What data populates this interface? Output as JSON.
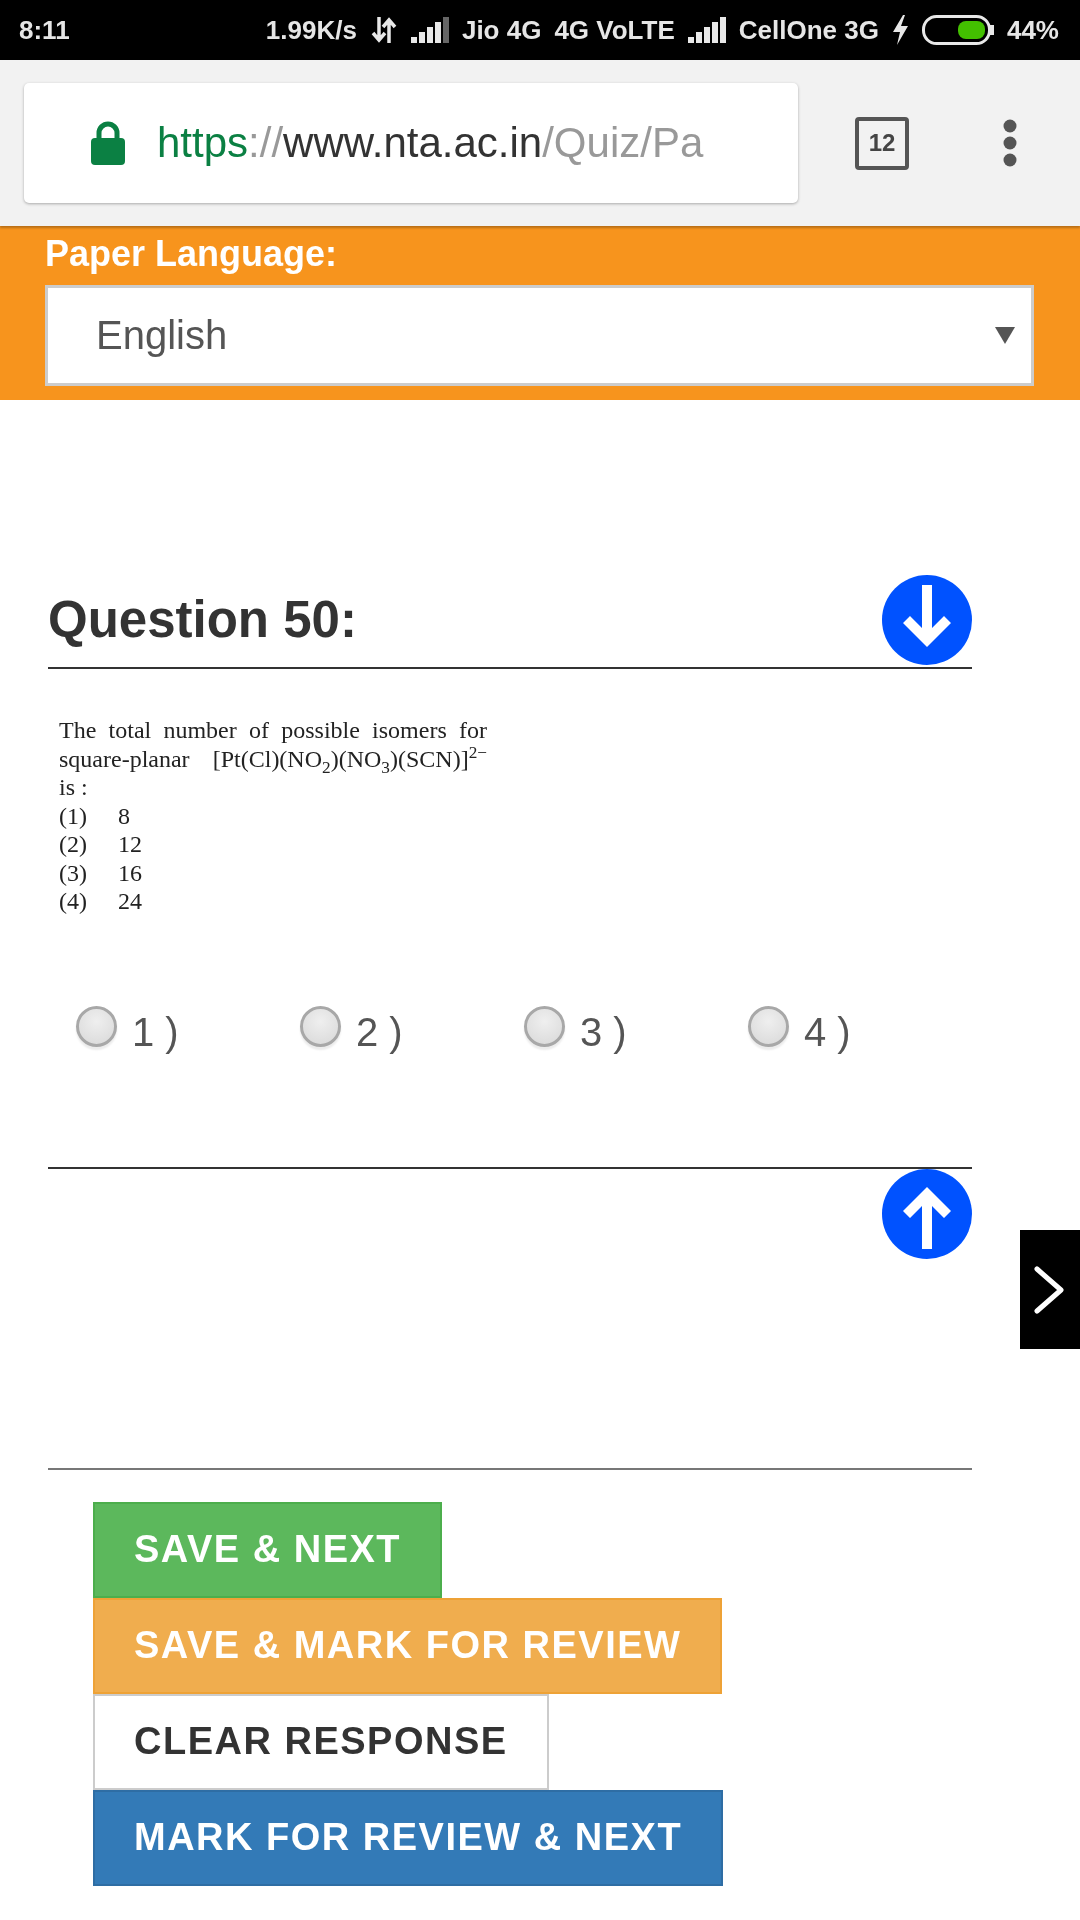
{
  "status_bar": {
    "time": "8:11",
    "net_speed": "1.99K/s",
    "carrier_1": "Jio 4G",
    "network_1": "4G VoLTE",
    "carrier_2": "CellOne 3G",
    "battery": "44%"
  },
  "browser_bar": {
    "url": {
      "scheme": "https",
      "separator": "://",
      "host": "www.nta.ac.in",
      "path": "/Quiz/Pa"
    },
    "tab_count": "12"
  },
  "language_bar": {
    "label": "Paper Language:",
    "select": {
      "value": "English"
    }
  },
  "question": {
    "title": "Question 50:",
    "text": "The total number of possible isomers for square-planar [Pt(Cl)(NO$_{2}$)(NO$_{3}$)(SCN)]$^{2−}$ is :",
    "choices": [
      {
        "number": "(1)",
        "value": "8"
      },
      {
        "number": "(2)",
        "value": "12"
      },
      {
        "number": "(3)",
        "value": "16"
      },
      {
        "number": "(4)",
        "value": "24"
      }
    ]
  },
  "answer_options": [
    {
      "label": "1 )",
      "selected": false
    },
    {
      "label": "2 )",
      "selected": false
    },
    {
      "label": "3 )",
      "selected": false
    },
    {
      "label": "4 )",
      "selected": false
    }
  ],
  "buttons": [
    {
      "label": "SAVE & NEXT",
      "kind": "success"
    },
    {
      "label": "SAVE & MARK FOR REVIEW",
      "kind": "warning"
    },
    {
      "label": "CLEAR RESPONSE",
      "kind": "default"
    },
    {
      "label": "MARK FOR REVIEW & NEXT",
      "kind": "primary"
    }
  ]
}
